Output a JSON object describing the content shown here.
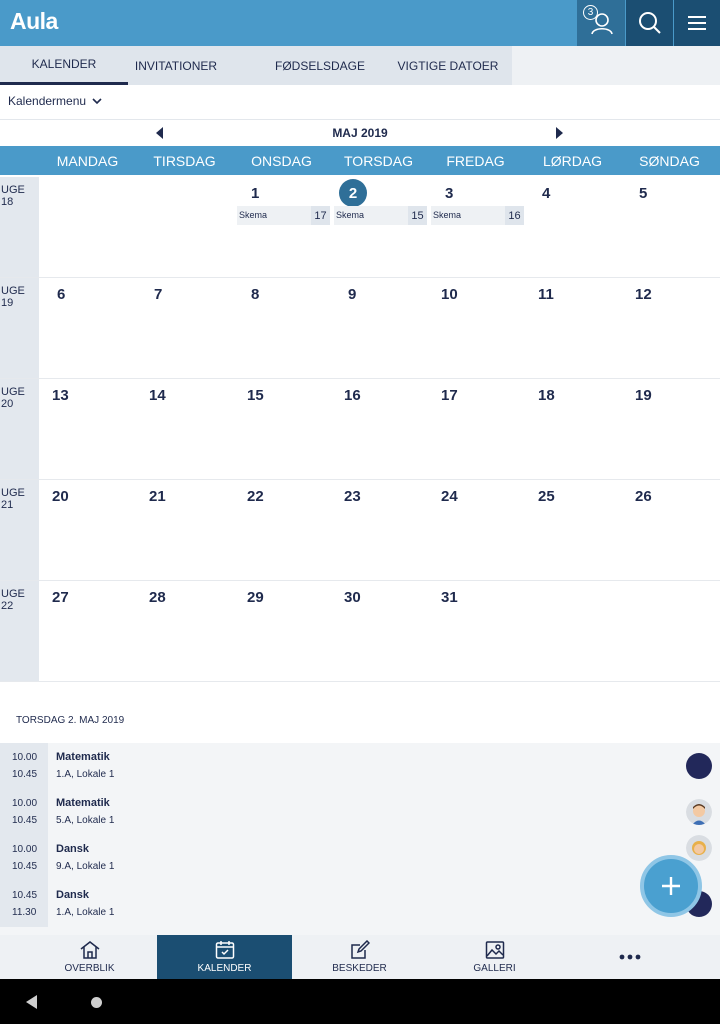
{
  "app": {
    "logo": "Aula",
    "notification_count": "3"
  },
  "tabs": [
    {
      "label": "KALENDER",
      "active": true
    },
    {
      "label": "INVITATIONER",
      "active": false
    },
    {
      "label": "FØDSELSDAGE",
      "active": false
    },
    {
      "label": "VIGTIGE DATOER",
      "active": false
    }
  ],
  "calendar_menu": "Kalendermenu",
  "month_title": "MAJ 2019",
  "day_names": [
    "MANDAG",
    "TIRSDAG",
    "ONSDAG",
    "TORSDAG",
    "FREDAG",
    "LØRDAG",
    "SØNDAG"
  ],
  "weeks": [
    {
      "label": "UGE 18",
      "days": [
        "",
        "",
        "1",
        "2",
        "3",
        "4",
        "5"
      ]
    },
    {
      "label": "UGE 19",
      "days": [
        "6",
        "7",
        "8",
        "9",
        "10",
        "11",
        "12"
      ]
    },
    {
      "label": "UGE 20",
      "days": [
        "13",
        "14",
        "15",
        "16",
        "17",
        "18",
        "19"
      ]
    },
    {
      "label": "UGE 21",
      "days": [
        "20",
        "21",
        "22",
        "23",
        "24",
        "25",
        "26"
      ]
    },
    {
      "label": "UGE 22",
      "days": [
        "27",
        "28",
        "29",
        "30",
        "31",
        "",
        ""
      ]
    }
  ],
  "week18_events": [
    {
      "label": "Skema",
      "count": "17"
    },
    {
      "label": "Skema",
      "count": "15"
    },
    {
      "label": "Skema",
      "count": "16"
    }
  ],
  "selected_date": "TORSDAG 2. MAJ 2019",
  "events": [
    {
      "start": "10.00",
      "end": "10.45",
      "title": "Matematik",
      "subtitle": "1.A, Lokale 1"
    },
    {
      "start": "10.00",
      "end": "10.45",
      "title": "Matematik",
      "subtitle": "5.A, Lokale 1"
    },
    {
      "start": "10.00",
      "end": "10.45",
      "title": "Dansk",
      "subtitle": "9.A, Lokale 1"
    },
    {
      "start": "10.45",
      "end": "11.30",
      "title": "Dansk",
      "subtitle": "1.A, Lokale 1"
    }
  ],
  "bottom_nav": [
    {
      "label": "OVERBLIK",
      "icon": "home-icon"
    },
    {
      "label": "KALENDER",
      "icon": "calendar-icon",
      "active": true
    },
    {
      "label": "BESKEDER",
      "icon": "edit-icon"
    },
    {
      "label": "GALLERI",
      "icon": "image-icon"
    },
    {
      "label": "",
      "icon": "more-icon"
    }
  ],
  "colors": {
    "primary": "#4a9ac9",
    "dark": "#1b4e72",
    "text": "#1f2a4d"
  }
}
